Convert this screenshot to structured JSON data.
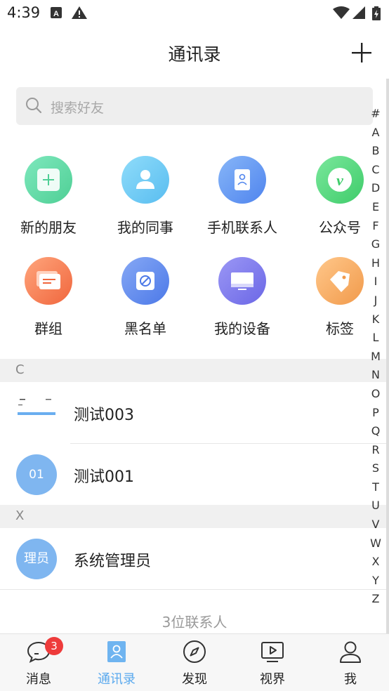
{
  "status_bar": {
    "time": "4:39"
  },
  "header": {
    "title": "通讯录"
  },
  "search": {
    "placeholder": "搜索好友"
  },
  "features": [
    {
      "label": "新的朋友",
      "icon": "plus-icon",
      "color": "#5fd7a3"
    },
    {
      "label": "我的同事",
      "icon": "person-icon",
      "color": "#6cc8f5"
    },
    {
      "label": "手机联系人",
      "icon": "contact-card-icon",
      "color": "#5f95f2"
    },
    {
      "label": "公众号",
      "icon": "v-icon",
      "color": "#4fd67d"
    },
    {
      "label": "群组",
      "icon": "chat-bubbles-icon",
      "color": "#f57b52"
    },
    {
      "label": "黑名单",
      "icon": "block-icon",
      "color": "#5b87ee"
    },
    {
      "label": "我的设备",
      "icon": "monitor-icon",
      "color": "#7a78ec"
    },
    {
      "label": "标签",
      "icon": "tag-icon",
      "color": "#f7a95e"
    }
  ],
  "sections": [
    {
      "letter": "C",
      "contacts": [
        {
          "name": "测试003",
          "avatar": ""
        },
        {
          "name": "测试001",
          "avatar": "01"
        }
      ]
    },
    {
      "letter": "X",
      "contacts": [
        {
          "name": "系统管理员",
          "avatar": "理员"
        }
      ]
    }
  ],
  "index_letters": [
    "#",
    "A",
    "B",
    "C",
    "D",
    "E",
    "F",
    "G",
    "H",
    "I",
    "J",
    "K",
    "L",
    "M",
    "N",
    "O",
    "P",
    "Q",
    "R",
    "S",
    "T",
    "U",
    "V",
    "W",
    "X",
    "Y",
    "Z"
  ],
  "footer": {
    "count": "3位联系人"
  },
  "tabbar": {
    "tabs": [
      {
        "label": "消息",
        "icon": "message-icon",
        "badge": "3"
      },
      {
        "label": "通讯录",
        "icon": "contacts-icon",
        "active": true
      },
      {
        "label": "发现",
        "icon": "compass-icon"
      },
      {
        "label": "视界",
        "icon": "video-icon"
      },
      {
        "label": "我",
        "icon": "profile-icon"
      }
    ]
  },
  "colors": {
    "accent": "#5aa9ee",
    "badge": "#ee3b3b"
  }
}
